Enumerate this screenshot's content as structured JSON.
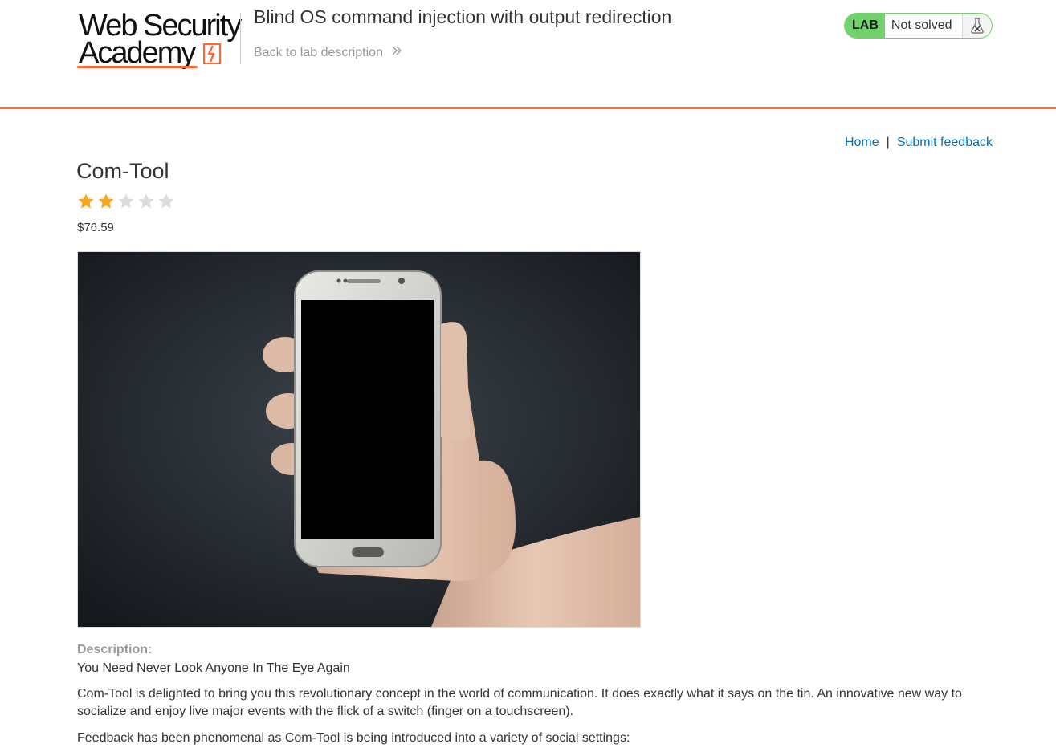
{
  "header": {
    "logo": {
      "line1": "Web Security",
      "line2": "Academy"
    },
    "lab_title": "Blind OS command injection with output redirection",
    "back_link_label": "Back to lab description",
    "status": {
      "tag": "LAB",
      "text": "Not solved",
      "icon": "flask-icon"
    }
  },
  "nav": {
    "home_label": "Home",
    "separator": "|",
    "feedback_label": "Submit feedback"
  },
  "product": {
    "name": "Com-Tool",
    "rating": 2,
    "rating_max": 5,
    "price": "$76.59",
    "image_alt": "hand holding a smartphone",
    "description_label": "Description:",
    "headline": "You Need Never Look Anyone In The Eye Again",
    "paragraphs": [
      "Com-Tool is delighted to bring you this revolutionary concept in the world of communication. It does exactly what it says on the tin. An innovative new way to socialize and enjoy live major events with the flick of a switch (finger on a touchscreen).",
      "Feedback has been phenomenal as Com-Tool is being introduced into a variety of social settings:"
    ]
  },
  "colors": {
    "accent_orange": "#ff6633",
    "link_blue": "#0071bc",
    "lab_green": "#70d16d",
    "star_filled": "#f5a623",
    "star_empty": "#dcdcdc"
  }
}
